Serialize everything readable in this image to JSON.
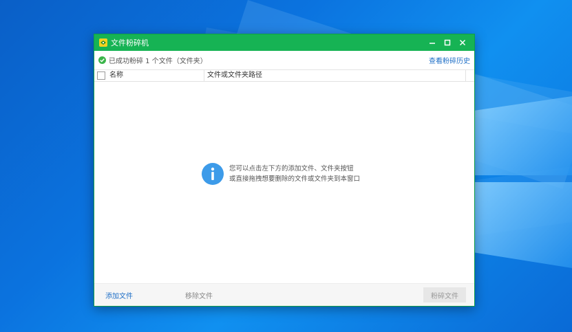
{
  "window": {
    "title": "文件粉碎机",
    "controls": {
      "minimize": "–",
      "maximize": "□",
      "close": "✕"
    }
  },
  "status": {
    "message": "已成功粉碎 1 个文件（文件夹）",
    "history_link": "查看粉碎历史"
  },
  "table": {
    "columns": [
      "名称",
      "文件或文件夹路径"
    ]
  },
  "empty_hint": {
    "line1": "您可以点击左下方的添加文件、文件夹按钮",
    "line2": "或直接拖拽想要删除的文件或文件夹到本窗口"
  },
  "footer": {
    "add_file": "添加文件",
    "remove_file": "移除文件",
    "shred": "粉碎文件"
  },
  "colors": {
    "titlebar": "#16b354",
    "link": "#1f6fc7",
    "info_icon": "#3d9be9",
    "desktop": "#0b73df"
  },
  "icons": [
    "app-shredder-icon",
    "success-check-icon",
    "info-icon",
    "minimize-icon",
    "maximize-icon",
    "close-icon"
  ]
}
